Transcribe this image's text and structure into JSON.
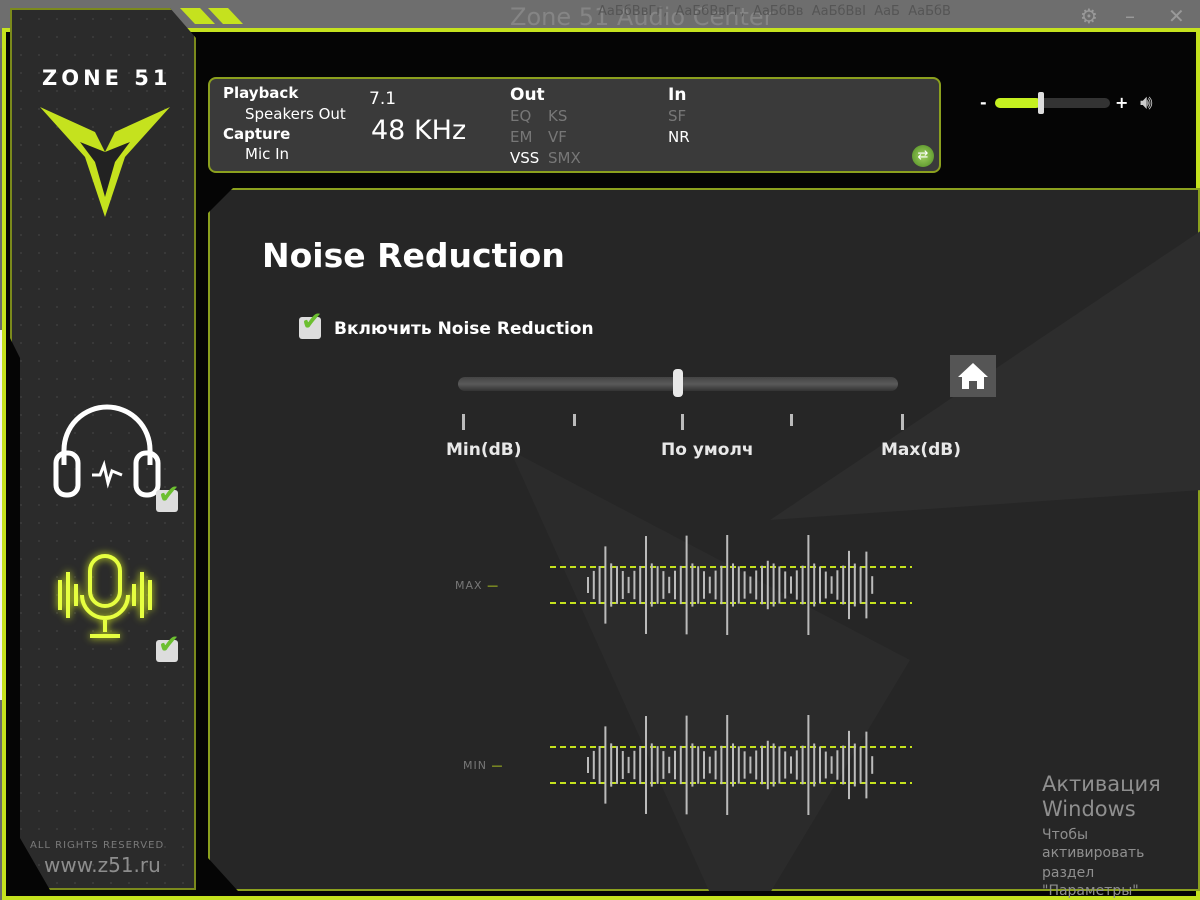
{
  "window_title": "Zone 51 Audio Center",
  "background_window": {
    "styles": [
      "АаБбВвГг,",
      "АаБбВвГг,",
      "АаБбВв",
      "АаБбВвІ",
      "АаБ",
      "АаБбВ"
    ]
  },
  "brand": {
    "logo": "ZONE 51",
    "rights": "ALL RIGHTS RESERVED",
    "website": "www.z51.ru",
    "accent": "#c5e21e"
  },
  "info": {
    "playback_label": "Playback",
    "playback_device": "Speakers Out",
    "capture_label": "Capture",
    "capture_device": "Mic In",
    "channels": "7.1",
    "sample_rate": "48 KHz",
    "out_label": "Out",
    "out_items": [
      {
        "t": "EQ",
        "on": false
      },
      {
        "t": "KS",
        "on": false
      },
      {
        "t": "EM",
        "on": false
      },
      {
        "t": "VF",
        "on": false
      },
      {
        "t": "VSS",
        "on": true
      },
      {
        "t": "SMX",
        "on": false
      }
    ],
    "in_label": "In",
    "in_items": [
      {
        "t": "SF",
        "on": false
      },
      {
        "t": "NR",
        "on": true
      }
    ]
  },
  "volume": {
    "minus": "-",
    "plus": "+",
    "level_percent": 40
  },
  "sidebar": {
    "headphones_enabled": true,
    "microphone_enabled": true
  },
  "main": {
    "title": "Noise Reduction",
    "enable_label": "Включить Noise Reduction",
    "enabled": true,
    "slider_value_percent": 50,
    "min_label": "Min(dB)",
    "default_label": "По умолч",
    "max_label": "Max(dB)",
    "wave_max_label": "MAX",
    "wave_min_label": "MIN"
  },
  "activation": {
    "title": "Активация Windows",
    "line1": "Чтобы активировать",
    "line2": "раздел \"Параметры\""
  }
}
